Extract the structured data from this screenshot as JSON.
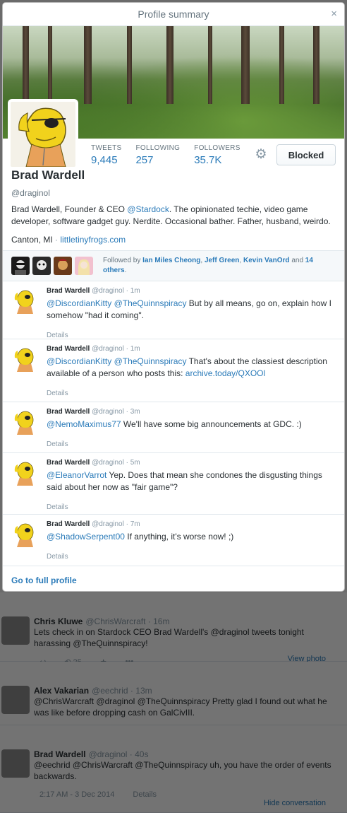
{
  "modal": {
    "title": "Profile summary",
    "close_label": "×",
    "go_to_full_profile": "Go to full profile"
  },
  "profile": {
    "name": "Brad Wardell",
    "handle": "@draginol",
    "bio_prefix": "Brad Wardell, Founder & CEO ",
    "bio_mention": "@Stardock",
    "bio_suffix": ". The opinionated techie, video game developer, software gadget guy. Nerdite. Occasional bather. Father, husband, weirdo.",
    "location": "Canton, MI",
    "separator": "·",
    "website": "littletinyfrogs.com",
    "stats": [
      {
        "label": "TWEETS",
        "value": "9,445"
      },
      {
        "label": "FOLLOWING",
        "value": "257"
      },
      {
        "label": "FOLLOWERS",
        "value": "35.7K"
      }
    ],
    "blocked_label": "Blocked",
    "gear_icon": "gear-icon"
  },
  "followed_by": {
    "prefix": "Followed by ",
    "name1": "Ian Miles Cheong",
    "sep1": ", ",
    "name2": "Jeff Green",
    "sep2": ", ",
    "name3": "Kevin VanOrd",
    "and_text": " and ",
    "others": "14 others",
    "period": "."
  },
  "tweets": [
    {
      "name": "Brad Wardell",
      "handle": "@draginol",
      "time": "· 1m",
      "m1": "@DiscordianKitty",
      "m2": "@TheQuinnspiracy",
      "text": "But by all means, go on, explain how I somehow \"had it coming\".",
      "link": "",
      "details": "Details"
    },
    {
      "name": "Brad Wardell",
      "handle": "@draginol",
      "time": "· 1m",
      "m1": "@DiscordianKitty",
      "m2": "@TheQuinnspiracy",
      "text": "That's about the classiest description available of a person who posts this:",
      "link": "archive.today/QXOOl",
      "details": "Details"
    },
    {
      "name": "Brad Wardell",
      "handle": "@draginol",
      "time": "· 3m",
      "m1": "@NemoMaximus77",
      "m2": "",
      "text": "We'll have some big announcements at GDC. :)",
      "link": "",
      "details": "Details"
    },
    {
      "name": "Brad Wardell",
      "handle": "@draginol",
      "time": "· 5m",
      "m1": "@EleanorVarrot",
      "m2": "",
      "text": "Yep. Does that mean she condones the disgusting things said about her now as \"fair game\"?",
      "link": "",
      "details": "Details"
    },
    {
      "name": "Brad Wardell",
      "handle": "@draginol",
      "time": "· 7m",
      "m1": "@ShadowSerpent00",
      "m2": "",
      "text": "If anything, it's worse now! ;)",
      "link": "",
      "details": "Details"
    }
  ],
  "background": {
    "t1": {
      "name": "Chris Kluwe",
      "handle": "@ChrisWarcraft · 16m",
      "text": "Lets check in on Stardock CEO Brad Wardell's @draginol tweets tonight harassing @TheQuinnspiracy!",
      "retweets": "25",
      "right": "View photo"
    },
    "t2": {
      "name": "Alex Vakarian",
      "handle": "@eechrid · 13m",
      "text": "@ChrisWarcraft @draginol @TheQuinnspiracy Pretty glad I found out what he was like before dropping cash on GalCivIII.",
      "right": ""
    },
    "t3": {
      "name": "Brad Wardell",
      "handle": "@draginol · 40s",
      "text": "@eechrid @ChrisWarcraft @TheQuinnspiracy uh, you have the order of events backwards.",
      "timestamp": "2:17 AM - 3 Dec 2014",
      "details": "Details",
      "right": "Hide conversation"
    }
  },
  "colors": {
    "link": "#2b7bb9",
    "text": "#292f33",
    "muted": "#8899a6"
  }
}
